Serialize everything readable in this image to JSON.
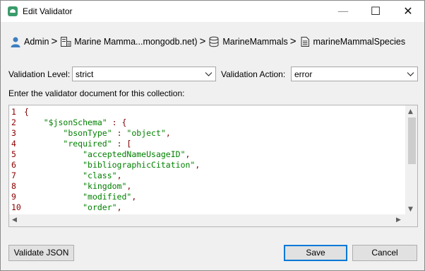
{
  "window": {
    "title": "Edit Validator",
    "minimize_glyph": "—",
    "maximize_glyph": "☐",
    "close_glyph": "✕"
  },
  "breadcrumb": {
    "items": [
      {
        "label": "Admin",
        "icon": "user-icon"
      },
      {
        "label": "Marine Mamma...mongodb.net)",
        "icon": "server-icon"
      },
      {
        "label": "MarineMammals",
        "icon": "database-icon"
      },
      {
        "label": "marineMammalSpecies",
        "icon": "collection-icon"
      }
    ],
    "separator": ">"
  },
  "validation_level": {
    "label": "Validation Level:",
    "value": "strict"
  },
  "validation_action": {
    "label": "Validation Action:",
    "value": "error"
  },
  "editor": {
    "prompt": "Enter the validator document for this collection:",
    "lines": [
      {
        "num": "1",
        "text": "{"
      },
      {
        "num": "2",
        "text": "    \"$jsonSchema\" : {"
      },
      {
        "num": "3",
        "text": "        \"bsonType\" : \"object\","
      },
      {
        "num": "4",
        "text": "        \"required\" : ["
      },
      {
        "num": "5",
        "text": "            \"acceptedNameUsageID\","
      },
      {
        "num": "6",
        "text": "            \"bibliographicCitation\","
      },
      {
        "num": "7",
        "text": "            \"class\","
      },
      {
        "num": "8",
        "text": "            \"kingdom\","
      },
      {
        "num": "9",
        "text": "            \"modified\","
      },
      {
        "num": "10",
        "text": "            \"order\","
      }
    ]
  },
  "buttons": {
    "validate": "Validate JSON",
    "save": "Save",
    "cancel": "Cancel"
  },
  "colors": {
    "brand": "#3a9b6b",
    "default_button_border": "#0078d7",
    "line_number": "#8b0000",
    "code_key": "#800000",
    "code_string": "#008000"
  }
}
